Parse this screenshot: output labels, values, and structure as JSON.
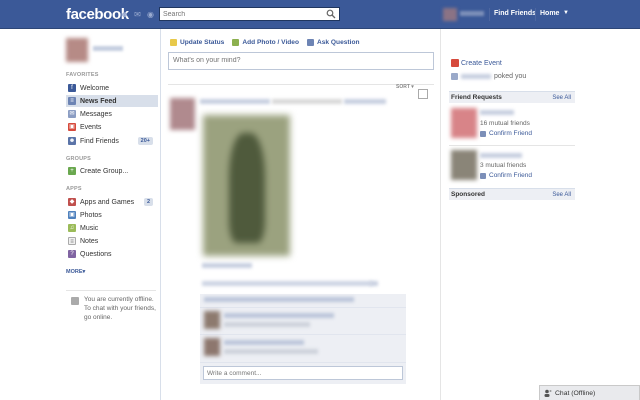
{
  "topbar": {
    "logo": "facebook",
    "search_placeholder": "Search",
    "find_friends": "Find Friends",
    "home": "Home"
  },
  "sidebar": {
    "favorites_heading": "FAVORITES",
    "favorites": [
      {
        "label": "Welcome",
        "icon": "welcome-icon"
      },
      {
        "label": "News Feed",
        "icon": "news-feed-icon"
      },
      {
        "label": "Messages",
        "icon": "messages-icon"
      },
      {
        "label": "Events",
        "icon": "events-icon"
      },
      {
        "label": "Find Friends",
        "icon": "find-friends-icon",
        "count": "20+"
      }
    ],
    "groups_heading": "GROUPS",
    "groups": [
      {
        "label": "Create Group...",
        "icon": "create-group-icon"
      }
    ],
    "apps_heading": "APPS",
    "apps": [
      {
        "label": "Apps and Games",
        "icon": "apps-games-icon",
        "count": "2"
      },
      {
        "label": "Photos",
        "icon": "photos-icon"
      },
      {
        "label": "Music",
        "icon": "music-icon"
      },
      {
        "label": "Notes",
        "icon": "notes-icon"
      },
      {
        "label": "Questions",
        "icon": "questions-icon"
      }
    ],
    "more": "MORE",
    "offline_text": "You are currently offline. To chat with your friends, go online."
  },
  "composer": {
    "tabs": [
      {
        "label": "Update Status",
        "icon": "status-icon"
      },
      {
        "label": "Add Photo / Video",
        "icon": "photo-icon"
      },
      {
        "label": "Ask Question",
        "icon": "question-icon"
      }
    ],
    "placeholder": "What's on your mind?"
  },
  "feed": {
    "sort_label": "SORT",
    "comment_placeholder": "Write a comment..."
  },
  "right": {
    "create_event": "Create Event",
    "poked_you": "poked you",
    "friend_requests_title": "Friend Requests",
    "see_all": "See All",
    "requests": [
      {
        "mutual": "16 mutual friends",
        "confirm": "Confirm Friend"
      },
      {
        "mutual": "3 mutual friends",
        "confirm": "Confirm Friend"
      }
    ],
    "sponsored_title": "Sponsored",
    "sponsored_see_all": "See All"
  },
  "chat": {
    "label": "Chat (Offline)"
  },
  "colors": {
    "brand": "#3b5998",
    "link": "#3b5998",
    "highlight": "#d8dfea"
  }
}
